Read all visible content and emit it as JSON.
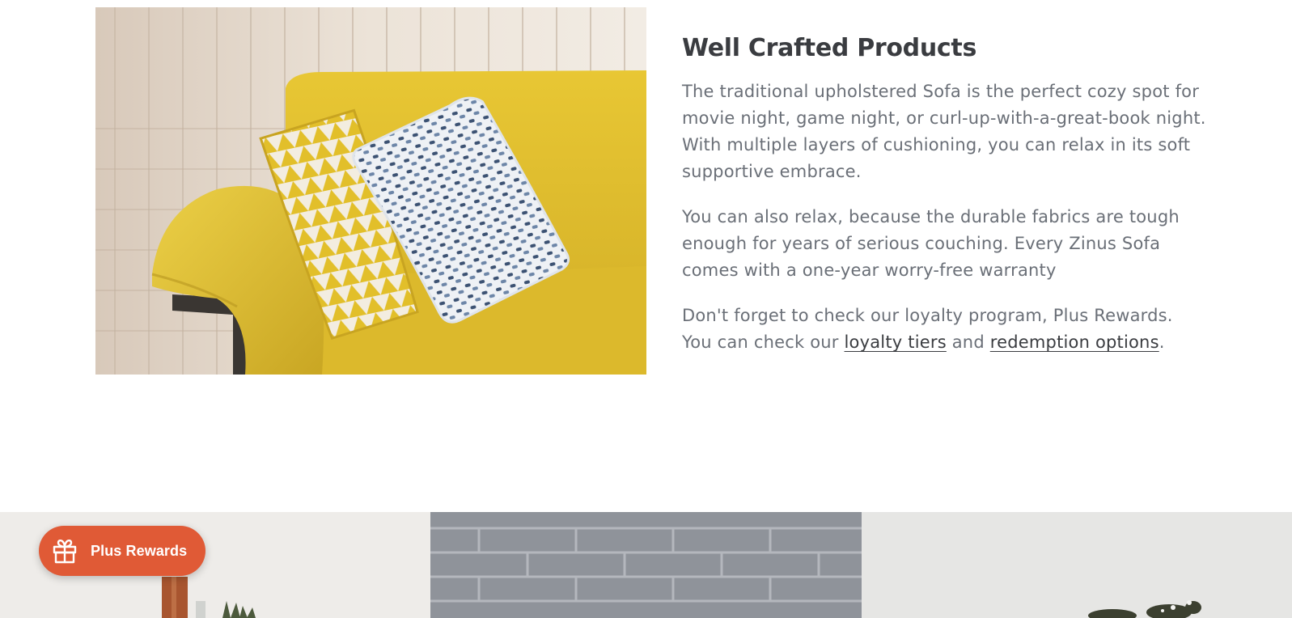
{
  "feature": {
    "image_alt": "Yellow sofa with patterned pillows",
    "title": "Well Crafted Products",
    "paragraph_1": "The traditional upholstered Sofa is the perfect cozy spot for movie night, game night, or curl-up-with-a-great-book night. With multiple layers of cushioning, you can relax in its soft supportive embrace.",
    "paragraph_2": "You can also relax, because the durable fabrics are tough enough for years of serious couching. Every Zinus Sofa comes with a one-year worry-free warranty",
    "paragraph_3_prefix": "Don't forget to check our loyalty program, Plus Rewards. You can check our",
    "paragraph_3_link_1": "loyalty tiers",
    "paragraph_3_conjunction": "and",
    "paragraph_3_link_2": "redemption options",
    "paragraph_3_suffix": "."
  },
  "tiles": [
    {
      "name": "tile-left"
    },
    {
      "name": "tile-middle"
    },
    {
      "name": "tile-right"
    }
  ],
  "rewards_launcher": {
    "label": "Plus Rewards",
    "icon": "gift-icon",
    "color": "#e05a36"
  },
  "colors": {
    "heading": "#3a3c40",
    "body_text": "#6a6f77",
    "sofa": "#e3c22f"
  }
}
